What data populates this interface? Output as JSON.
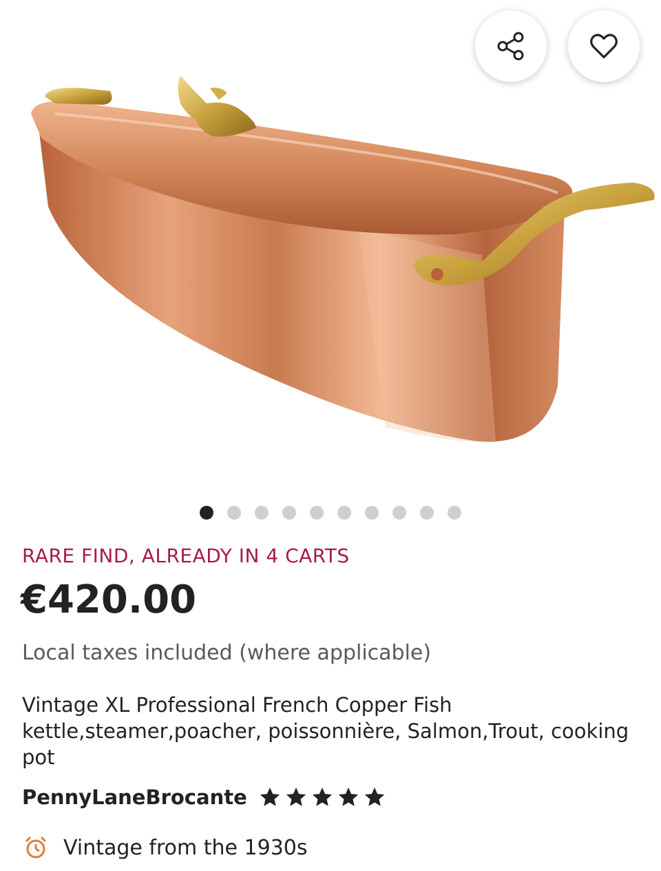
{
  "product_image": {
    "alt": "Vintage copper fish kettle with brass fish handle"
  },
  "actions": {
    "share_icon": "share-icon",
    "favorite_icon": "heart-icon"
  },
  "carousel": {
    "total": 10,
    "active_index": 0
  },
  "badge": "RARE FIND, ALREADY IN 4 CARTS",
  "price": "€420.00",
  "tax_note": "Local taxes included (where applicable)",
  "title": "Vintage XL Professional French Copper Fish kettle,steamer,poacher, poissonnière, Salmon,Trout, cooking pot",
  "shop": {
    "name": "PennyLaneBrocante",
    "rating": 5,
    "rating_max": 5
  },
  "vintage": {
    "icon": "alarm-clock-icon",
    "text": "Vintage from the 1930s"
  },
  "colors": {
    "badge": "#a61a4c",
    "text": "#222222",
    "muted": "#595959",
    "vintage_icon": "#e07b39"
  }
}
